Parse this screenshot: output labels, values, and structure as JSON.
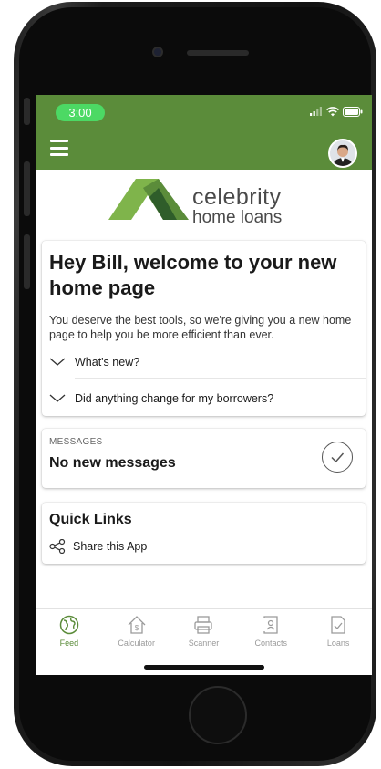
{
  "status_bar": {
    "time": "3:00"
  },
  "brand": {
    "line1": "celebrity",
    "line2": "home loans",
    "color_dark": "#5b8c3a",
    "color_light": "#7fb44b"
  },
  "welcome": {
    "title": "Hey Bill, welcome to your new home page",
    "body": "You deserve the best tools, so we're giving you a new home page to help you be more efficient than ever.",
    "faqs": [
      {
        "label": "What's new?"
      },
      {
        "label": "Did anything change for my borrowers?"
      }
    ]
  },
  "messages": {
    "header": "MESSAGES",
    "text": "No new messages"
  },
  "quick_links": {
    "title": "Quick Links",
    "items": [
      {
        "label": "Share this App",
        "icon": "share-icon"
      }
    ]
  },
  "tabs": [
    {
      "label": "Feed",
      "icon": "globe-icon",
      "active": true
    },
    {
      "label": "Calculator",
      "icon": "calculator-icon",
      "active": false
    },
    {
      "label": "Scanner",
      "icon": "scanner-icon",
      "active": false
    },
    {
      "label": "Contacts",
      "icon": "contacts-icon",
      "active": false
    },
    {
      "label": "Loans",
      "icon": "loans-icon",
      "active": false
    }
  ],
  "colors": {
    "accent": "#5b8c3a",
    "time_pill": "#4cd964"
  }
}
